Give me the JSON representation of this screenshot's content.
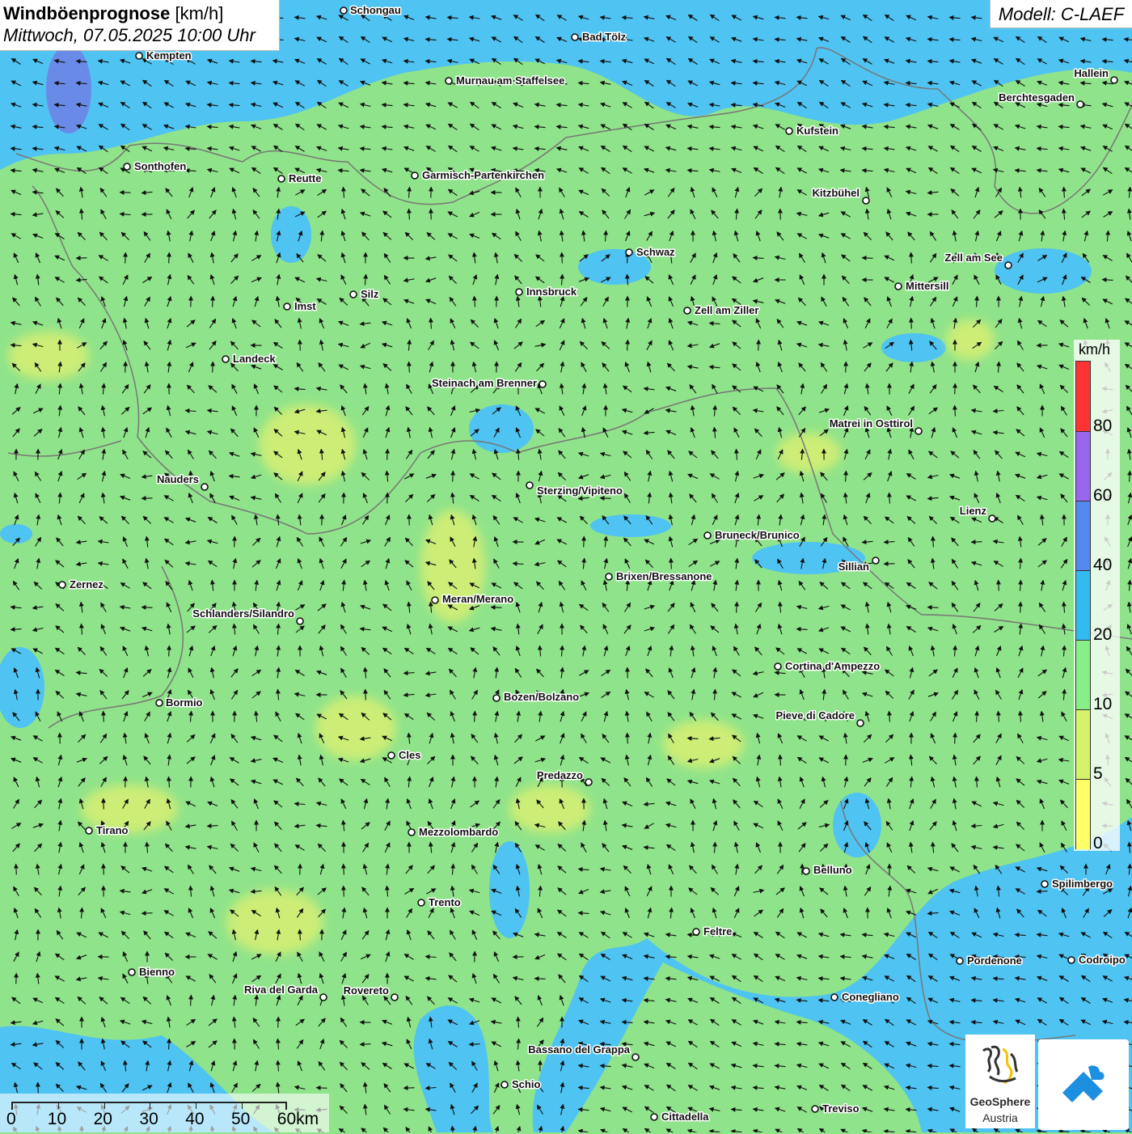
{
  "title": {
    "main": "Windböenprognose",
    "unit": "[km/h]",
    "datetime": "Mittwoch, 07.05.2025 10:00 Uhr"
  },
  "model": "Modell: C-LAEF",
  "legend": {
    "unit": "km/h",
    "ticks": [
      "80",
      "60",
      "40",
      "20",
      "10",
      "5",
      "0"
    ],
    "colors": [
      "#ff3333",
      "#9966ee",
      "#5588ee",
      "#33bbf0",
      "#88ee88",
      "#d4f26a",
      "#ffff66"
    ]
  },
  "scale_bar": {
    "labels": [
      "0",
      "10",
      "20",
      "30",
      "40",
      "50",
      "60km"
    ]
  },
  "logos": {
    "geosphere_name": "GeoSphere",
    "geosphere_sub": "Austria"
  },
  "cities": [
    {
      "name": "Schongau"
    },
    {
      "name": "Bad Tölz"
    },
    {
      "name": "Kempten"
    },
    {
      "name": "Murnau am Staffelsee"
    },
    {
      "name": "Hallein"
    },
    {
      "name": "Berchtesgaden"
    },
    {
      "name": "Kufstein"
    },
    {
      "name": "Sonthofen"
    },
    {
      "name": "Reutte"
    },
    {
      "name": "Garmisch-Partenkirchen"
    },
    {
      "name": "Kitzbühel"
    },
    {
      "name": "Schwaz"
    },
    {
      "name": "Zell am See"
    },
    {
      "name": "Mittersill"
    },
    {
      "name": "Silz"
    },
    {
      "name": "Innsbruck"
    },
    {
      "name": "Imst"
    },
    {
      "name": "Zell am Ziller"
    },
    {
      "name": "Landeck"
    },
    {
      "name": "Steinach am Brenner"
    },
    {
      "name": "Matrei in Osttirol"
    },
    {
      "name": "Nauders"
    },
    {
      "name": "Sterzing/Vipiteno"
    },
    {
      "name": "Lienz"
    },
    {
      "name": "Bruneck/Brunico"
    },
    {
      "name": "Sillian"
    },
    {
      "name": "Zernez"
    },
    {
      "name": "Brixen/Bressanone"
    },
    {
      "name": "Meran/Merano"
    },
    {
      "name": "Schlanders/Silandro"
    },
    {
      "name": "Cortina d'Ampezzo"
    },
    {
      "name": "Bozen/Bolzano"
    },
    {
      "name": "Bormio"
    },
    {
      "name": "Pieve di Cadore"
    },
    {
      "name": "Cles"
    },
    {
      "name": "Predazzo"
    },
    {
      "name": "Tirano"
    },
    {
      "name": "Mezzolombardo"
    },
    {
      "name": "Belluno"
    },
    {
      "name": "Spilimbergo"
    },
    {
      "name": "Trento"
    },
    {
      "name": "Feltre"
    },
    {
      "name": "Pordenone"
    },
    {
      "name": "Codroipo"
    },
    {
      "name": "Bienno"
    },
    {
      "name": "Riva del Garda"
    },
    {
      "name": "Rovereto"
    },
    {
      "name": "Conegliano"
    },
    {
      "name": "Bassano del Grappa"
    },
    {
      "name": "Schio"
    },
    {
      "name": "Treviso"
    },
    {
      "name": "Cittadella"
    }
  ]
}
